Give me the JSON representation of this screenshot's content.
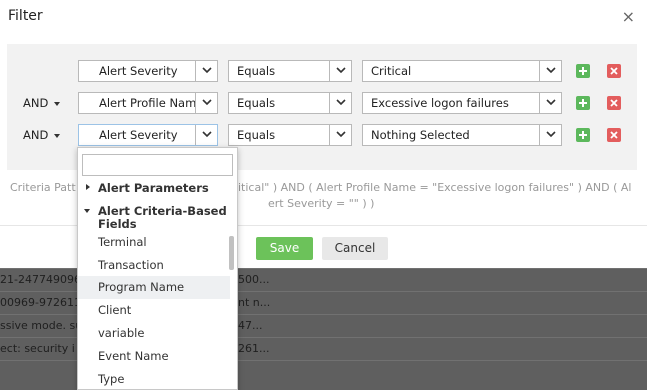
{
  "background_rows": [
    {
      "c1": "21-247749096",
      "c2": "500..."
    },
    {
      "c1": "00969-972611",
      "c2": "nt n..."
    },
    {
      "c1": "ssive mode. sul",
      "c2": "47..."
    },
    {
      "c1": "ect: security i",
      "c2": "261..."
    },
    {
      "c1": "",
      "c2": ""
    }
  ],
  "modal": {
    "title": "Filter",
    "close_symbol": "×"
  },
  "filter_rows": [
    {
      "connector": "",
      "field": "Alert Severity",
      "operator": "Equals",
      "value": "Critical"
    },
    {
      "connector": "AND",
      "field": "Alert Profile Nam",
      "operator": "Equals",
      "value": "Excessive logon failures"
    },
    {
      "connector": "AND",
      "field": "Alert Severity",
      "operator": "Equals",
      "value": "Nothing Selected"
    }
  ],
  "criteria": {
    "prefix": "Criteria Patt",
    "line1_rest": "itical\" ) AND ( Alert Profile Name = \"Excessive logon failures\" ) AND ( Al",
    "line2": "ert Severity = \"\" ) )"
  },
  "buttons": {
    "save": "Save",
    "cancel": "Cancel"
  },
  "dropdown": {
    "search_value": "",
    "groups": [
      {
        "label": "Alert Parameters",
        "expanded": false
      },
      {
        "label": "Alert Criteria-Based Fields",
        "expanded": true
      }
    ],
    "items": [
      "Terminal",
      "Transaction",
      "Program Name",
      "Client",
      "variable",
      "Event Name",
      "Type"
    ],
    "hovered_item": "Program Name"
  },
  "colors": {
    "add": "#5cb85c",
    "delete": "#e35d5d",
    "save": "#6cc25a"
  },
  "icons": {
    "dropdown_arrow": "chevron-down-icon",
    "add": "plus-icon",
    "delete": "x-icon",
    "close": "close-icon"
  }
}
